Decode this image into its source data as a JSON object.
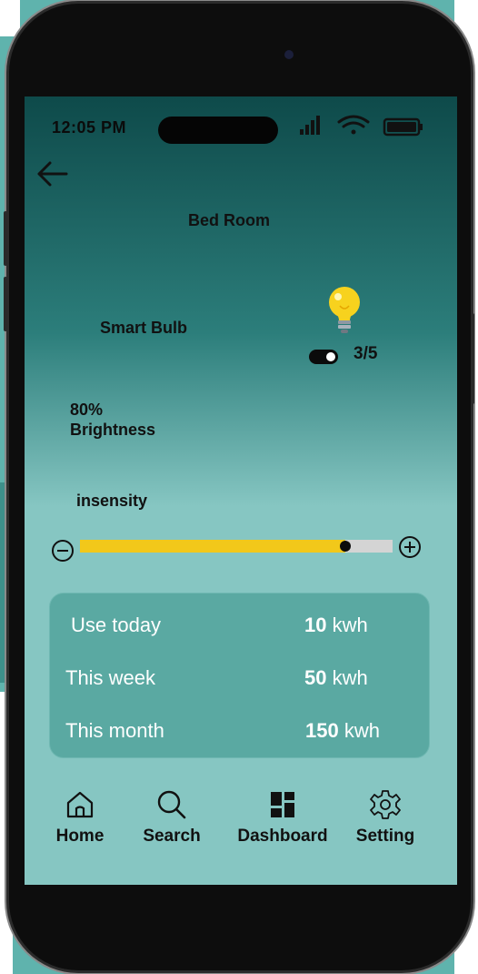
{
  "status": {
    "time": "12:05 PM"
  },
  "header": {
    "back_icon": "arrow-left-icon",
    "room_title": "Bed Room"
  },
  "device": {
    "name": "Smart Bulb",
    "icon": "light-bulb-icon",
    "toggle_on": true,
    "count": "3/5"
  },
  "brightness": {
    "value": "80%",
    "label": "Brightness"
  },
  "intensity": {
    "label": "insensity",
    "level_fraction": 0.85
  },
  "usage": [
    {
      "label": "Use today",
      "value": "10",
      "unit": "kwh"
    },
    {
      "label": "This week",
      "value": "50",
      "unit": "kwh"
    },
    {
      "label": "This month",
      "value": "150",
      "unit": "kwh"
    }
  ],
  "nav": [
    {
      "label": "Home",
      "icon": "home-icon"
    },
    {
      "label": "Search",
      "icon": "search-icon"
    },
    {
      "label": "Dashboard",
      "icon": "dashboard-icon"
    },
    {
      "label": "Setting",
      "icon": "gear-icon"
    }
  ],
  "colors": {
    "slider_fill": "#f2c81a",
    "card_bg": "#5aa9a2",
    "bulb": "#f7d21e"
  }
}
